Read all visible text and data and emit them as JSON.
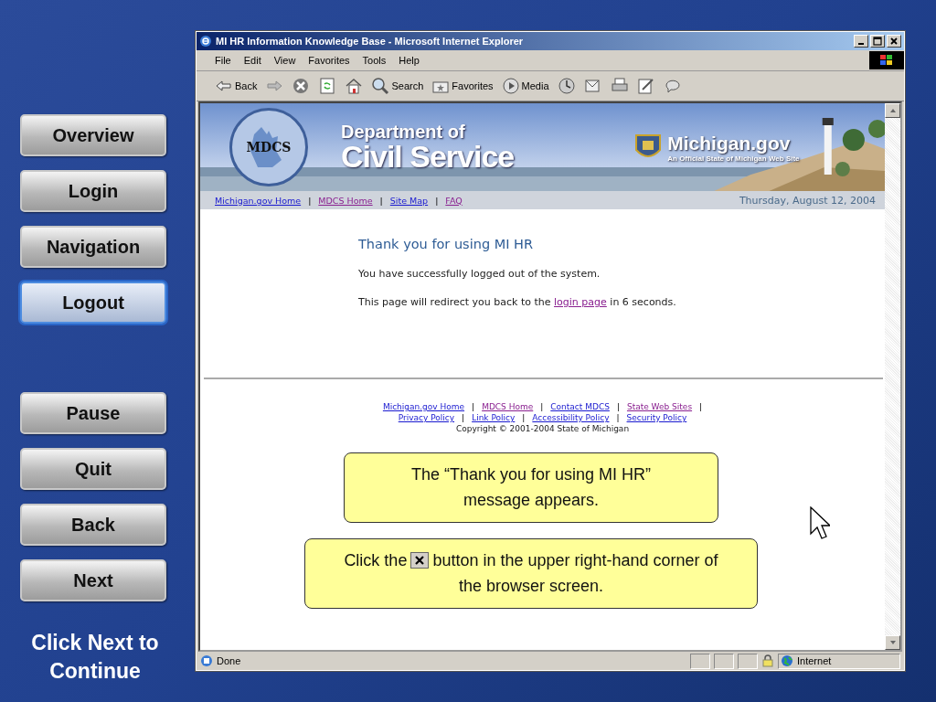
{
  "lesson_nav": {
    "items": [
      {
        "label": "Overview",
        "selected": false
      },
      {
        "label": "Login",
        "selected": false
      },
      {
        "label": "Navigation",
        "selected": false
      },
      {
        "label": "Logout",
        "selected": true
      }
    ]
  },
  "controls": [
    {
      "label": "Pause"
    },
    {
      "label": "Quit"
    },
    {
      "label": "Back"
    },
    {
      "label": "Next"
    }
  ],
  "hint": "Click Next to Continue",
  "browser": {
    "title": "MI HR Information Knowledge Base - Microsoft Internet Explorer",
    "menu": [
      "File",
      "Edit",
      "View",
      "Favorites",
      "Tools",
      "Help"
    ],
    "toolbar": [
      {
        "kind": "back",
        "label": "Back"
      },
      {
        "kind": "forward"
      },
      {
        "kind": "stop"
      },
      {
        "kind": "refresh"
      },
      {
        "kind": "home"
      },
      {
        "kind": "search",
        "label": "Search"
      },
      {
        "kind": "favorites",
        "label": "Favorites"
      },
      {
        "kind": "media",
        "label": "Media"
      },
      {
        "kind": "history"
      },
      {
        "kind": "mail"
      },
      {
        "kind": "print"
      },
      {
        "kind": "edit"
      },
      {
        "kind": "discuss"
      }
    ],
    "status": "Done",
    "zone": "Internet"
  },
  "page": {
    "banner": {
      "seal": "MDCS",
      "dept_line1": "Department of",
      "dept_line2": "Civil Service",
      "portal": "Michigan.gov",
      "tagline": "An Official State of Michigan Web Site"
    },
    "separator": "|",
    "top_links": [
      {
        "label": "Michigan.gov Home",
        "visited": false
      },
      {
        "label": "MDCS Home",
        "visited": true
      },
      {
        "label": "Site Map",
        "visited": false
      },
      {
        "label": "FAQ",
        "visited": true
      }
    ],
    "date": "Thursday, August 12, 2004",
    "heading": "Thank you for using MI HR",
    "message": "You have successfully logged out of the system.",
    "redirect": {
      "before": "This page will redirect you back to the",
      "link": "login page",
      "after": "in 6 seconds."
    },
    "footer_links": [
      [
        {
          "label": "Michigan.gov Home",
          "visited": false
        },
        {
          "label": "MDCS Home",
          "visited": true
        },
        {
          "label": "Contact MDCS",
          "visited": false
        },
        {
          "label": "State Web Sites",
          "visited": true
        }
      ],
      [
        {
          "label": "Privacy Policy",
          "visited": false
        },
        {
          "label": "Link Policy",
          "visited": false
        },
        {
          "label": "Accessibility Policy",
          "visited": false
        },
        {
          "label": "Security Policy",
          "visited": false
        }
      ]
    ],
    "copyright": "Copyright © 2001-2004 State of Michigan"
  },
  "callouts": [
    {
      "kind": "text",
      "text": "The “Thank you for using MI HR” message appears."
    },
    {
      "kind": "button",
      "before": "Click the",
      "after": "button in the upper right-hand corner of the browser screen."
    }
  ]
}
